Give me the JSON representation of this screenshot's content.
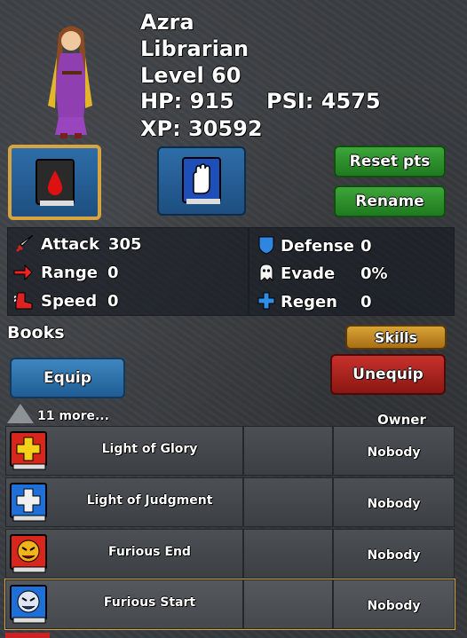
{
  "character": {
    "name": "Azra",
    "class": "Librarian",
    "level": "Level 60",
    "hp": "HP: 915",
    "psi": "PSI: 4575",
    "xp": "XP: 30592"
  },
  "buttons": {
    "reset": "Reset pts",
    "rename": "Rename",
    "skills": "Skills",
    "equip": "Equip",
    "unequip": "Unequip"
  },
  "stats": {
    "attack": {
      "label": "Attack",
      "value": "305"
    },
    "range": {
      "label": "Range",
      "value": "0"
    },
    "speed": {
      "label": "Speed",
      "value": "0"
    },
    "defense": {
      "label": "Defense",
      "value": "0"
    },
    "evade": {
      "label": "Evade",
      "value": "0%"
    },
    "regen": {
      "label": "Regen",
      "value": "0"
    }
  },
  "books": {
    "heading": "Books",
    "more": "11 more...",
    "owner_header": "Owner",
    "rows": [
      {
        "title": "Light of Glory",
        "owner": "Nobody",
        "icon": "glory-book-icon"
      },
      {
        "title": "Light of Judgment",
        "owner": "Nobody",
        "icon": "judgment-book-icon"
      },
      {
        "title": "Furious End",
        "owner": "Nobody",
        "icon": "furious-end-book-icon"
      },
      {
        "title": "Furious Start",
        "owner": "Nobody",
        "icon": "furious-start-book-icon"
      }
    ]
  },
  "colors": {
    "selected_border": "#d6a540",
    "green_button": "#2f9530",
    "red_button": "#b0241f",
    "blue_button": "#2e6da8",
    "gold_button": "#c48c28"
  }
}
